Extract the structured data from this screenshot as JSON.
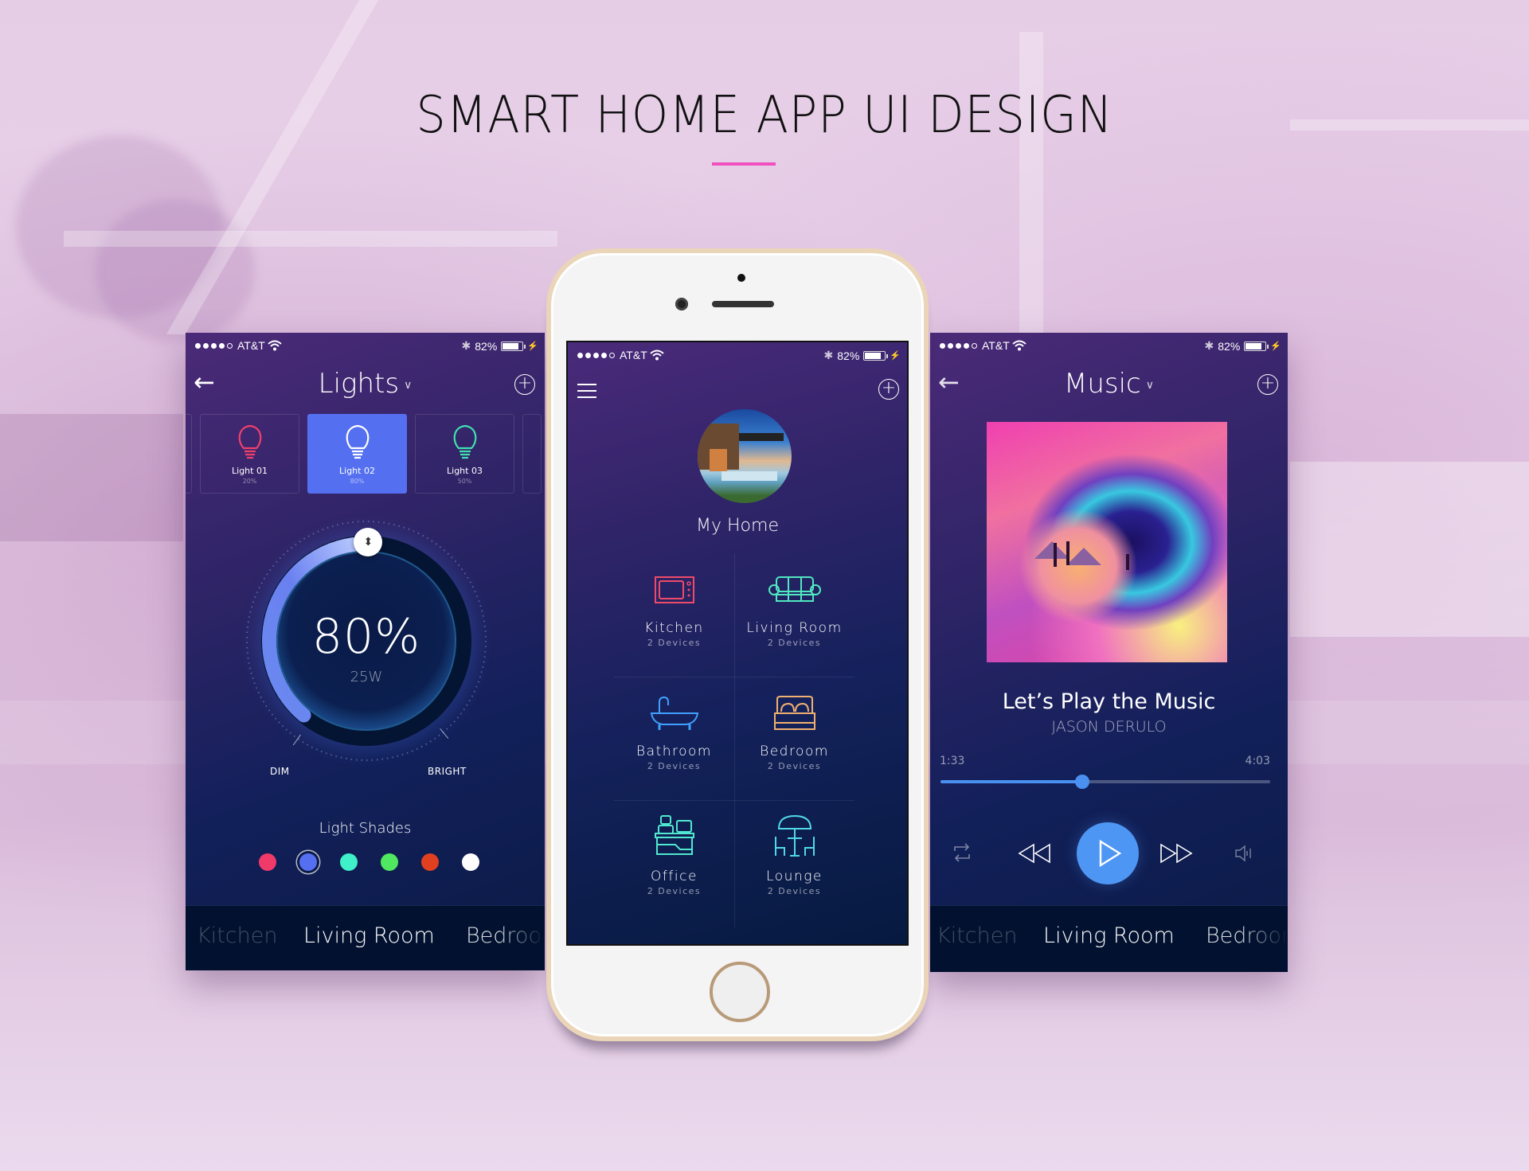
{
  "page": {
    "title": "SMART HOME APP UI DESIGN",
    "accent_color": "#f050c0"
  },
  "status_bar": {
    "carrier": "AT&T",
    "signal_bars_filled": 4,
    "signal_bars_total": 5,
    "battery": "82%",
    "battery_level": 0.82
  },
  "lights_screen": {
    "nav": {
      "back_icon": "arrow-left-icon",
      "title": "Lights",
      "add_icon": "plus-circle-icon"
    },
    "cards": [
      {
        "name": "Light 01",
        "value": "20%",
        "color": "#f0406a",
        "active": false
      },
      {
        "name": "Light 02",
        "value": "80%",
        "color": "#ffffff",
        "active": true
      },
      {
        "name": "Light 03",
        "value": "50%",
        "color": "#40e0b0",
        "active": false
      }
    ],
    "dial": {
      "value": "80%",
      "level": 0.8,
      "watts": "25W",
      "min_label": "DIM",
      "max_label": "BRIGHT"
    },
    "shades": {
      "title": "Light Shades",
      "colors": [
        "#f03a6a",
        "#5470f0",
        "#3ff0c8",
        "#50e860",
        "#e04020",
        "#ffffff"
      ],
      "selected_index": 1
    },
    "room_tabs": [
      "Kitchen",
      "Living Room",
      "Bedroom"
    ],
    "active_room": "Living Room"
  },
  "home_screen": {
    "menu_icon": "hamburger-menu-icon",
    "add_icon": "plus-circle-icon",
    "home_name": "My Home",
    "rooms": [
      {
        "name": "Kitchen",
        "devices": "2 Devices",
        "icon": "microwave-icon",
        "color": "#f04a6a"
      },
      {
        "name": "Living Room",
        "devices": "2 Devices",
        "icon": "sofa-icon",
        "color": "#50e8c0"
      },
      {
        "name": "Bathroom",
        "devices": "2 Devices",
        "icon": "bathtub-icon",
        "color": "#40a0ff"
      },
      {
        "name": "Bedroom",
        "devices": "2 Devices",
        "icon": "bed-icon",
        "color": "#f0b070"
      },
      {
        "name": "Office",
        "devices": "2 Devices",
        "icon": "desk-icon",
        "color": "#50e8d0"
      },
      {
        "name": "Lounge",
        "devices": "2 Devices",
        "icon": "patio-table-icon",
        "color": "#50d8e8"
      }
    ]
  },
  "music_screen": {
    "nav": {
      "back_icon": "arrow-left-icon",
      "title": "Music",
      "add_icon": "plus-circle-icon"
    },
    "track_title": "Let’s Play the Music",
    "artist": "JASON DERULO",
    "current_time": "1:33",
    "total_time": "4:03",
    "progress": 0.43,
    "controls": [
      "repeat-icon",
      "rewind-icon",
      "play-icon",
      "fast-forward-icon",
      "volume-icon"
    ],
    "room_tabs": [
      "Kitchen",
      "Living Room",
      "Bedroom"
    ],
    "active_room": "Living Room"
  }
}
